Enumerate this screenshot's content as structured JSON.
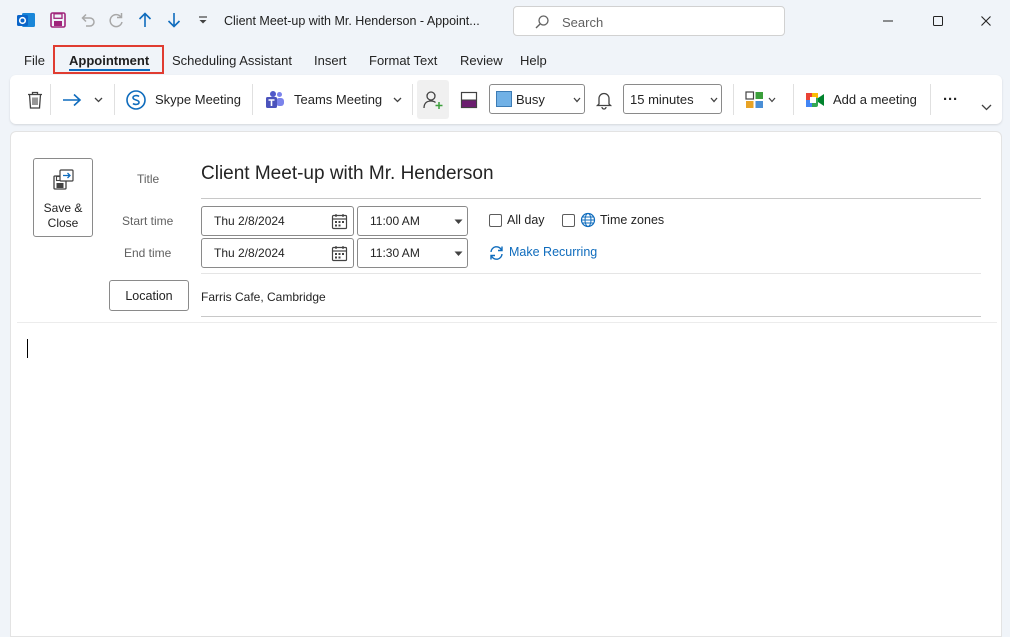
{
  "window": {
    "title": "Client Meet-up with Mr. Henderson  -  Appoint...",
    "search_placeholder": "Search"
  },
  "menu_tabs": [
    "File",
    "Appointment",
    "Scheduling Assistant",
    "Insert",
    "Format Text",
    "Review",
    "Help"
  ],
  "selected_tab": "Appointment",
  "ribbon": {
    "skype_label": "Skype Meeting",
    "teams_label": "Teams Meeting",
    "show_as_value": "Busy",
    "reminder_value": "15 minutes",
    "add_meeting_label": "Add a meeting",
    "more_label": "···"
  },
  "form": {
    "save_close_label": "Save &\nClose",
    "title_label": "Title",
    "title_value": "Client Meet-up with Mr. Henderson",
    "start_label": "Start time",
    "start_date": "Thu 2/8/2024",
    "start_time": "11:00 AM",
    "end_label": "End time",
    "end_date": "Thu 2/8/2024",
    "end_time": "11:30 AM",
    "all_day_label": "All day",
    "time_zones_label": "Time zones",
    "make_recurring_label": "Make Recurring",
    "location_button_label": "Location",
    "location_value": "Farris Cafe, Cambridge"
  },
  "colors": {
    "accent": "#0f6cbd",
    "selection_outline": "#e03c31",
    "outlook_blue": "#0a64c8",
    "save_purple": "#a0247b",
    "busy_fill": "#71b1e6"
  }
}
